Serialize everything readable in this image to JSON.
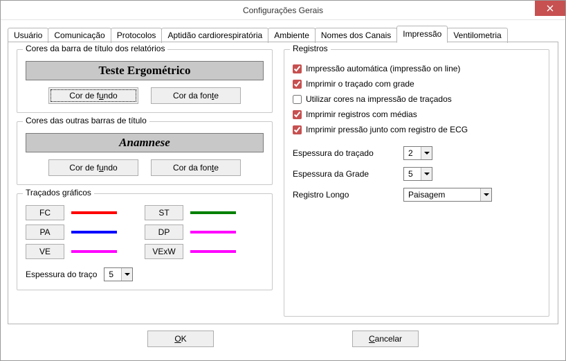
{
  "window": {
    "title": "Configurações Gerais"
  },
  "tabs": [
    {
      "label": "Usuário"
    },
    {
      "label": "Comunicação"
    },
    {
      "label": "Protocolos"
    },
    {
      "label": "Aptidão cardiorespiratória"
    },
    {
      "label": "Ambiente"
    },
    {
      "label": "Nomes dos Canais"
    },
    {
      "label": "Impressão"
    },
    {
      "label": "Ventilometria"
    }
  ],
  "left": {
    "group1": {
      "legend": "Cores da barra de título dos relatórios",
      "sample": "Teste Ergométrico",
      "btn_bg_prefix": "Cor de f",
      "btn_bg_u": "u",
      "btn_bg_suffix": "ndo",
      "btn_font_prefix": "Cor da fon",
      "btn_font_u": "t",
      "btn_font_suffix": "e"
    },
    "group2": {
      "legend": "Cores das outras barras de título",
      "sample": "Anamnese",
      "btn_bg_prefix": "Cor de f",
      "btn_bg_u": "u",
      "btn_bg_suffix": "ndo",
      "btn_font_prefix": "Cor da fon",
      "btn_font_u": "t",
      "btn_font_suffix": "e"
    },
    "group3": {
      "legend": "Traçados gráficos",
      "fc": "FC",
      "pa": "PA",
      "ve": "VE",
      "st": "ST",
      "dp": "DP",
      "vexw": "VExW",
      "thickness_label": "Espessura do traço",
      "thickness_value": "5"
    }
  },
  "right": {
    "legend": "Registros",
    "cb1": "Impressão automática  (impressão on line)",
    "cb2": "Imprimir o traçado com grade",
    "cb3": "Utilizar cores na impressão de traçados",
    "cb4": "Imprimir registros com médias",
    "cb5": "Imprimir pressão junto com registro de ECG",
    "f1_label": "Espessura do traçado",
    "f1_value": "2",
    "f2_label": "Espessura da Grade",
    "f2_value": "5",
    "f3_label": "Registro Longo",
    "f3_value": "Paisagem"
  },
  "footer": {
    "ok_u": "O",
    "ok_suffix": "K",
    "cancel_u": "C",
    "cancel_suffix": "ancelar"
  }
}
